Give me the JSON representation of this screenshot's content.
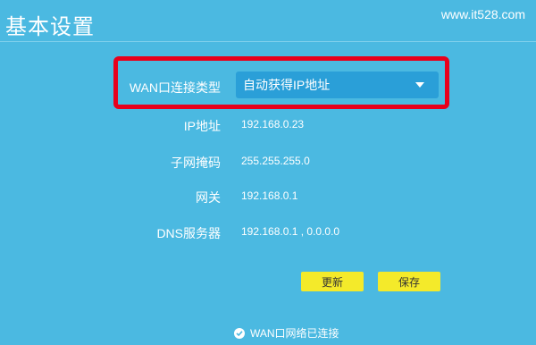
{
  "header": {
    "title": "基本设置",
    "watermark": "www.it528.com"
  },
  "form": {
    "connection_type_label": "WAN口连接类型",
    "connection_type_value": "自动获得IP地址",
    "ip_label": "IP地址",
    "ip_value": "192.168.0.23",
    "subnet_label": "子网掩码",
    "subnet_value": "255.255.255.0",
    "gateway_label": "网关",
    "gateway_value": "192.168.0.1",
    "dns_label": "DNS服务器",
    "dns_value": "192.168.0.1 , 0.0.0.0"
  },
  "actions": {
    "refresh_label": "更新",
    "save_label": "保存"
  },
  "status": {
    "text": "WAN口网络已连接"
  },
  "colors": {
    "background": "#4bb9e1",
    "select_bg": "#2a9fd8",
    "highlight_border": "#e8001c",
    "button_bg": "#f4ea2a"
  }
}
